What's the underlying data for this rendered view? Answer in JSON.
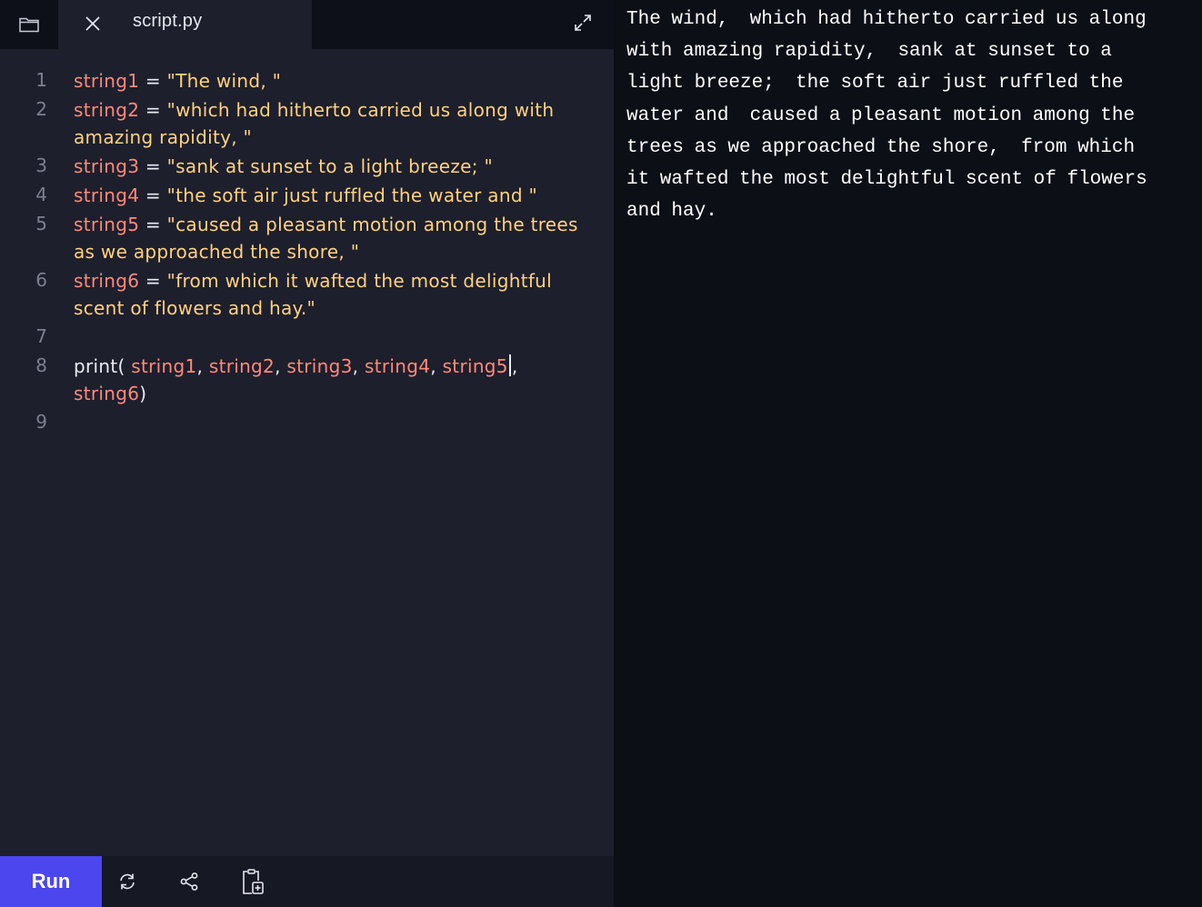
{
  "tabbar": {
    "folder_icon": "folder-icon",
    "close_icon": "close-icon",
    "filename": "script.py",
    "expand_icon": "expand-icon"
  },
  "editor": {
    "lines": [
      {
        "num": "1",
        "parts": [
          {
            "t": "var",
            "v": "string1"
          },
          {
            "t": "op",
            "v": " = "
          },
          {
            "t": "str",
            "v": "\"The wind, \""
          }
        ]
      },
      {
        "num": "2",
        "parts": [
          {
            "t": "var",
            "v": "string2"
          },
          {
            "t": "op",
            "v": " = "
          },
          {
            "t": "str",
            "v": "\"which had hitherto carried us along with amazing rapidity, \""
          }
        ]
      },
      {
        "num": "3",
        "parts": [
          {
            "t": "var",
            "v": "string3"
          },
          {
            "t": "op",
            "v": " = "
          },
          {
            "t": "str",
            "v": "\"sank at sunset to a light breeze; \""
          }
        ]
      },
      {
        "num": "4",
        "parts": [
          {
            "t": "var",
            "v": "string4"
          },
          {
            "t": "op",
            "v": " = "
          },
          {
            "t": "str",
            "v": "\"the soft air just ruffled the water and \""
          }
        ]
      },
      {
        "num": "5",
        "parts": [
          {
            "t": "var",
            "v": "string5"
          },
          {
            "t": "op",
            "v": " = "
          },
          {
            "t": "str",
            "v": "\"caused a pleasant motion among the trees as we approached the shore, \""
          }
        ]
      },
      {
        "num": "6",
        "parts": [
          {
            "t": "var",
            "v": "string6"
          },
          {
            "t": "op",
            "v": " = "
          },
          {
            "t": "str",
            "v": "\"from which it wafted the most delightful scent of flowers and hay.\""
          }
        ]
      },
      {
        "num": "7",
        "parts": []
      },
      {
        "num": "8",
        "parts": [
          {
            "t": "op",
            "v": "print( "
          },
          {
            "t": "var",
            "v": "string1"
          },
          {
            "t": "op",
            "v": ", "
          },
          {
            "t": "var",
            "v": "string2"
          },
          {
            "t": "op",
            "v": ", "
          },
          {
            "t": "var",
            "v": "string3"
          },
          {
            "t": "op",
            "v": ", "
          },
          {
            "t": "var",
            "v": "string4"
          },
          {
            "t": "op",
            "v": ", "
          },
          {
            "t": "var",
            "v": "string5"
          },
          {
            "t": "cursor",
            "v": ""
          },
          {
            "t": "op",
            "v": ", "
          },
          {
            "t": "var",
            "v": "string6"
          },
          {
            "t": "op",
            "v": ")"
          }
        ]
      },
      {
        "num": "9",
        "parts": []
      }
    ]
  },
  "toolbar": {
    "run_label": "Run",
    "refresh_icon": "refresh-icon",
    "share_icon": "share-icon",
    "clipboard_icon": "clipboard-add-icon"
  },
  "output": {
    "text": "The wind,  which had hitherto carried us along\nwith amazing rapidity,  sank at sunset to a\nlight breeze;  the soft air just ruffled the\nwater and  caused a pleasant motion among the\ntrees as we approached the shore,  from which\nit wafted the most delightful scent of flowers\nand hay."
  },
  "colors": {
    "accent": "#4c46ef",
    "variable": "#ff8a7a",
    "string": "#ffd280",
    "editor_bg": "#1d1f2d",
    "output_bg": "#0d0f17"
  }
}
